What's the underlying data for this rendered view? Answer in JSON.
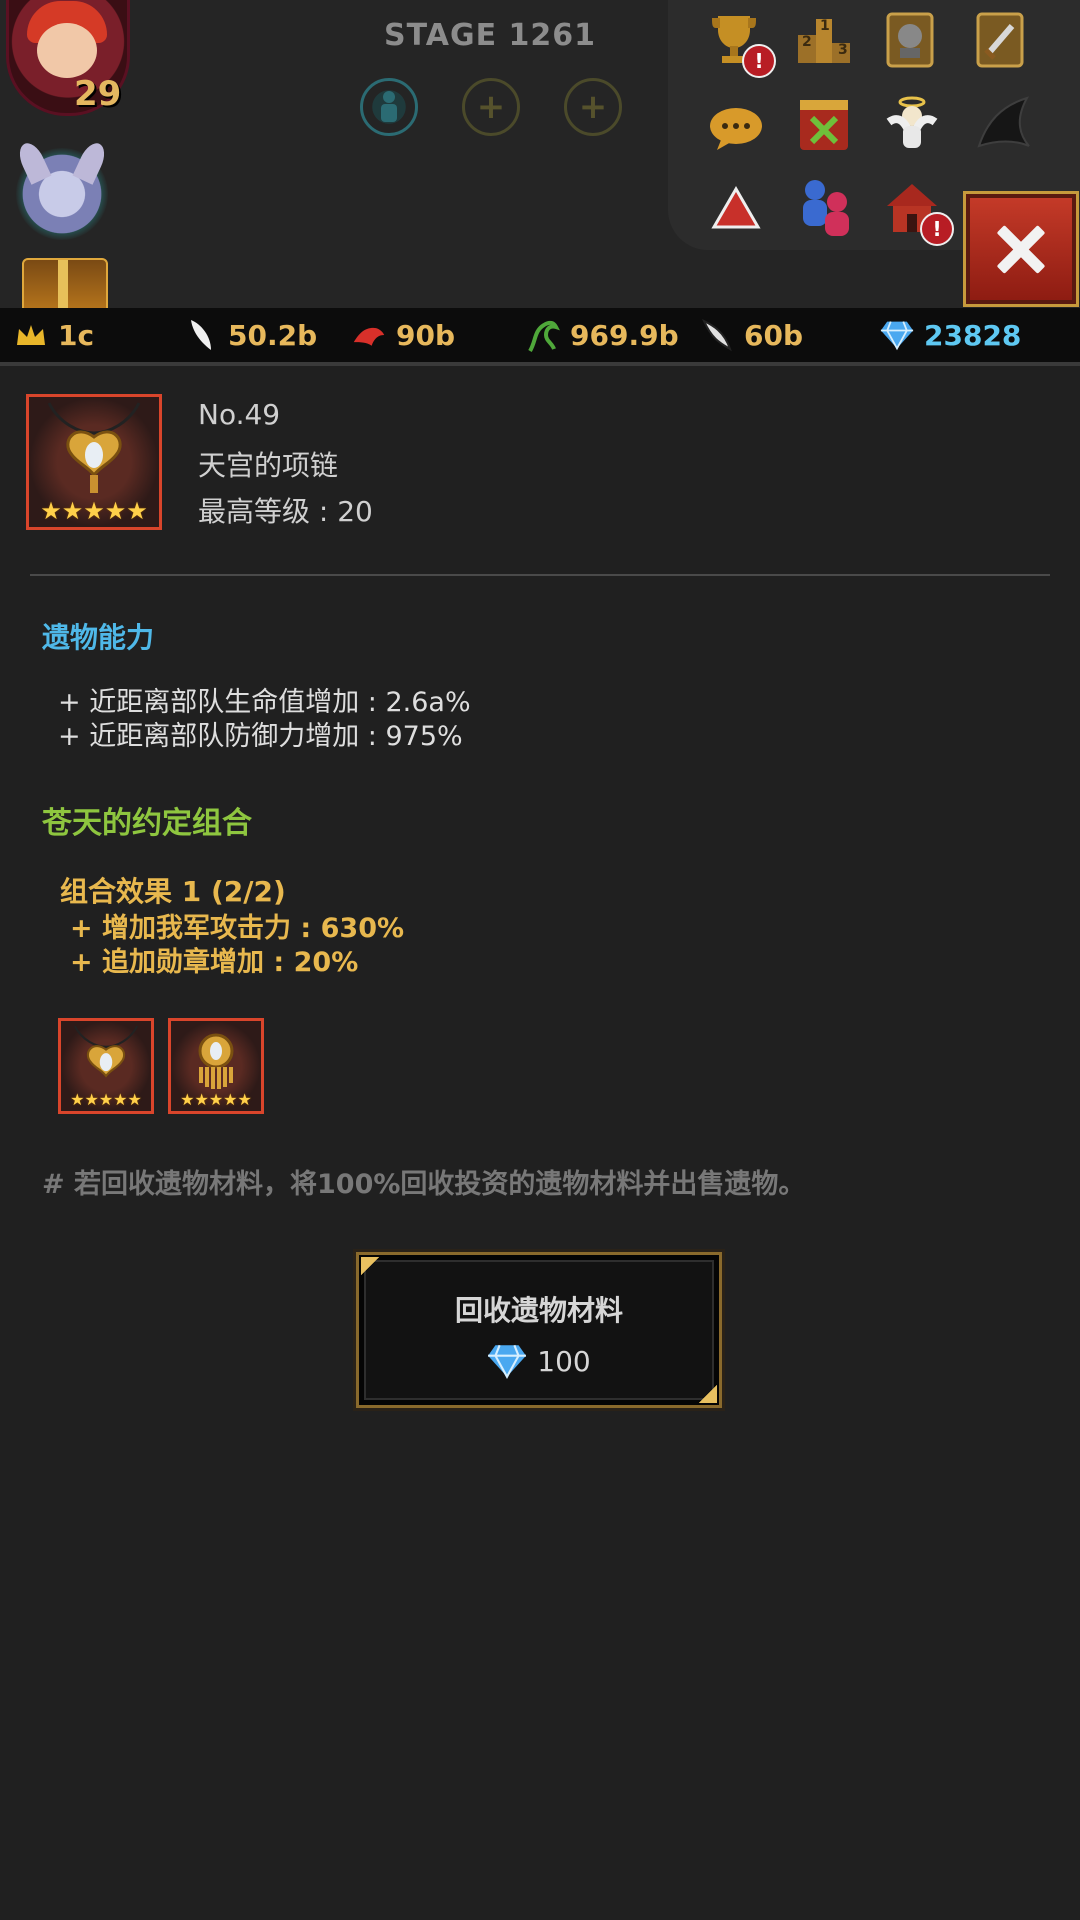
{
  "hud": {
    "stage_label": "STAGE 1261",
    "hero_level": "29",
    "equip_slots": [
      {
        "state": "filled"
      },
      {
        "state": "empty",
        "symbol": "+"
      },
      {
        "state": "empty",
        "symbol": "+"
      }
    ],
    "menu_icons": [
      {
        "name": "trophy-icon",
        "badge": "!"
      },
      {
        "name": "ranking-podium-icon",
        "podium": [
          "2",
          "1",
          "3"
        ]
      },
      {
        "name": "knight-card-icon"
      },
      {
        "name": "weapon-card-icon"
      },
      {
        "name": "chat-bubble-icon"
      },
      {
        "name": "guild-banner-icon"
      },
      {
        "name": "angel-icon"
      },
      {
        "name": "dark-wing-icon"
      },
      {
        "name": "warning-triangle-icon"
      },
      {
        "name": "friends-icon"
      },
      {
        "name": "house-icon",
        "badge": "!"
      }
    ]
  },
  "resources": [
    {
      "icon": "crown-icon",
      "value": "1c"
    },
    {
      "icon": "feather-icon",
      "value": "50.2b"
    },
    {
      "icon": "red-bird-icon",
      "value": "90b"
    },
    {
      "icon": "green-vine-icon",
      "value": "969.9b"
    },
    {
      "icon": "bone-wing-icon",
      "value": "60b"
    },
    {
      "icon": "diamond-icon",
      "value": "23828"
    }
  ],
  "item": {
    "number": "No.49",
    "name": "天宫的项链",
    "max_level": "最高等级 : 20",
    "stars": "★★★★★"
  },
  "abilities": {
    "title": "遗物能力",
    "lines": [
      "+ 近距离部队生命值增加 : 2.6a%",
      "+ 近距离部队防御力增加 : 975%"
    ]
  },
  "combo": {
    "title": "苍天的约定组合",
    "effect_title": "组合效果 1 (2/2)",
    "effects": [
      "+ 增加我军攻击力 : 630%",
      "+ 追加勋章增加 : 20%"
    ],
    "set_items": [
      {
        "icon": "necklace-icon",
        "stars": "★★★★★"
      },
      {
        "icon": "pendant-icon",
        "stars": "★★★★★"
      }
    ]
  },
  "note": "# 若回收遗物材料，将100%回收投资的遗物材料并出售遗物。",
  "recycle_button": {
    "label": "回收遗物材料",
    "cost": "100"
  },
  "colors": {
    "background": "#202020",
    "accent_blue": "#4fb8e8",
    "accent_green": "#8ec63f",
    "accent_gold": "#e8b84e",
    "frame_red": "#d9452b",
    "close_red": "#b52a1c"
  }
}
